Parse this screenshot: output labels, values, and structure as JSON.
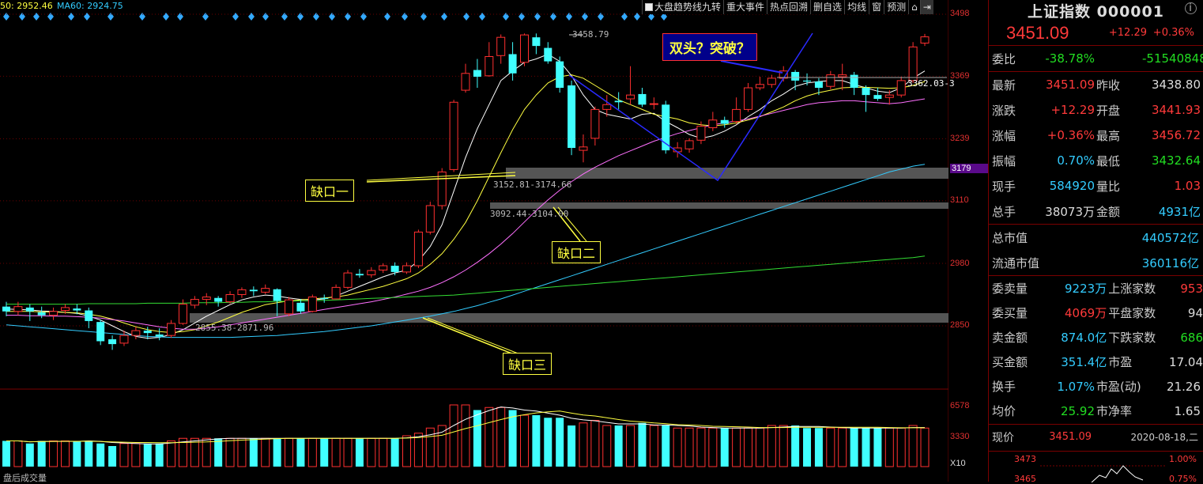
{
  "ma_legend": {
    "ma50": "50: 2952.46",
    "ma60": "MA60: 2924.75"
  },
  "toolbar": {
    "trend": "大盘趋势线九转",
    "events": "重大事件",
    "hot": "热点回溯",
    "delete": "删自选",
    "avg": "均线",
    "window": "窗",
    "forecast": "预测"
  },
  "yaxis": [
    "3498",
    "3369",
    "3239",
    "3179",
    "3110",
    "2980",
    "2850"
  ],
  "vol_axis": {
    "top": "6578",
    "mid": "3330",
    "unit": "X10"
  },
  "vol_label": "盘后成交量",
  "annotations": {
    "gap1": "缺口一",
    "gap2": "缺口二",
    "gap3": "缺口三",
    "question": "双头？突破？"
  },
  "labels": {
    "high": "3458.79",
    "gap1_range": "3152.81-3174.66",
    "gap2_range": "3092.44-3104.00",
    "gap3_range": "2855.38-2871.96",
    "ma_val": "3362.03-3"
  },
  "colors": {
    "up": "#ff3030",
    "down": "#40ffff",
    "ma5": "#ffffff",
    "ma10": "#ffff40",
    "ma20": "#ff70ff",
    "ma60": "#33ccff",
    "ma120": "#33dd33"
  },
  "chart_data": {
    "type": "candlestick",
    "ylim": [
      2760,
      3510
    ],
    "candles": [
      [
        2890,
        2880,
        2900,
        2870
      ],
      [
        2880,
        2890,
        2900,
        2872
      ],
      [
        2888,
        2880,
        2895,
        2860
      ],
      [
        2878,
        2872,
        2890,
        2866
      ],
      [
        2872,
        2880,
        2888,
        2862
      ],
      [
        2882,
        2888,
        2895,
        2875
      ],
      [
        2886,
        2882,
        2895,
        2874
      ],
      [
        2882,
        2860,
        2888,
        2845
      ],
      [
        2858,
        2818,
        2862,
        2810
      ],
      [
        2822,
        2812,
        2830,
        2800
      ],
      [
        2814,
        2830,
        2840,
        2808
      ],
      [
        2830,
        2840,
        2848,
        2822
      ],
      [
        2840,
        2835,
        2848,
        2822
      ],
      [
        2832,
        2828,
        2845,
        2820
      ],
      [
        2830,
        2855,
        2862,
        2825
      ],
      [
        2855,
        2895,
        2905,
        2852
      ],
      [
        2893,
        2905,
        2912,
        2886
      ],
      [
        2905,
        2910,
        2918,
        2893
      ],
      [
        2908,
        2900,
        2912,
        2890
      ],
      [
        2900,
        2915,
        2922,
        2896
      ],
      [
        2915,
        2925,
        2930,
        2908
      ],
      [
        2925,
        2922,
        2932,
        2912
      ],
      [
        2920,
        2928,
        2936,
        2916
      ],
      [
        2926,
        2902,
        2928,
        2870
      ],
      [
        2875,
        2904,
        2910,
        2870
      ],
      [
        2898,
        2880,
        2906,
        2875
      ],
      [
        2880,
        2910,
        2915,
        2878
      ],
      [
        2908,
        2906,
        2915,
        2898
      ],
      [
        2906,
        2930,
        2936,
        2905
      ],
      [
        2930,
        2960,
        2966,
        2926
      ],
      [
        2958,
        2955,
        2968,
        2950
      ],
      [
        2956,
        2965,
        2972,
        2950
      ],
      [
        2966,
        2975,
        2980,
        2960
      ],
      [
        2975,
        2962,
        2982,
        2955
      ],
      [
        2962,
        2975,
        2982,
        2958
      ],
      [
        2975,
        3045,
        3050,
        2970
      ],
      [
        3045,
        3100,
        3108,
        3040
      ],
      [
        3100,
        3170,
        3178,
        3092
      ],
      [
        3175,
        3315,
        3320,
        3170
      ],
      [
        3340,
        3375,
        3395,
        3335
      ],
      [
        3382,
        3368,
        3405,
        3345
      ],
      [
        3370,
        3410,
        3440,
        3368
      ],
      [
        3412,
        3450,
        3456,
        3395
      ],
      [
        3415,
        3375,
        3440,
        3360
      ],
      [
        3398,
        3455,
        3458,
        3390
      ],
      [
        3450,
        3432,
        3458,
        3415
      ],
      [
        3428,
        3400,
        3440,
        3395
      ],
      [
        3400,
        3345,
        3410,
        3335
      ],
      [
        3350,
        3220,
        3360,
        3205
      ],
      [
        3215,
        3222,
        3248,
        3190
      ],
      [
        3240,
        3300,
        3306,
        3225
      ],
      [
        3300,
        3310,
        3330,
        3285
      ],
      [
        3318,
        3315,
        3336,
        3300
      ],
      [
        3322,
        3330,
        3390,
        3310
      ],
      [
        3332,
        3310,
        3345,
        3305
      ],
      [
        3312,
        3312,
        3325,
        3300
      ],
      [
        3310,
        3215,
        3318,
        3208
      ],
      [
        3212,
        3220,
        3232,
        3200
      ],
      [
        3218,
        3235,
        3240,
        3210
      ],
      [
        3236,
        3265,
        3275,
        3228
      ],
      [
        3262,
        3278,
        3295,
        3255
      ],
      [
        3278,
        3270,
        3285,
        3262
      ],
      [
        3275,
        3300,
        3325,
        3270
      ],
      [
        3300,
        3345,
        3355,
        3295
      ],
      [
        3345,
        3352,
        3368,
        3340
      ],
      [
        3352,
        3365,
        3372,
        3345
      ],
      [
        3365,
        3380,
        3390,
        3358
      ],
      [
        3378,
        3360,
        3382,
        3340
      ],
      [
        3360,
        3358,
        3375,
        3350
      ],
      [
        3358,
        3345,
        3365,
        3330
      ],
      [
        3348,
        3372,
        3380,
        3342
      ],
      [
        3368,
        3372,
        3395,
        3340
      ],
      [
        3372,
        3345,
        3378,
        3330
      ],
      [
        3345,
        3330,
        3350,
        3295
      ],
      [
        3330,
        3322,
        3345,
        3318
      ],
      [
        3325,
        3330,
        3340,
        3310
      ],
      [
        3330,
        3360,
        3368,
        3325
      ],
      [
        3360,
        3430,
        3440,
        3355
      ],
      [
        3438,
        3451,
        3457,
        3432
      ]
    ],
    "volume": [
      10,
      10,
      9,
      10,
      10,
      10,
      10,
      10,
      9,
      8,
      9,
      9,
      9,
      9,
      10,
      11,
      11,
      11,
      11,
      11,
      11,
      11,
      11,
      11,
      11,
      11,
      11,
      11,
      11,
      11,
      11,
      11,
      11,
      11,
      12,
      13,
      15,
      16,
      24,
      24,
      22,
      23,
      23,
      22,
      20,
      20,
      19,
      19,
      16,
      17,
      18,
      16,
      16,
      16,
      17,
      16,
      16,
      15,
      15,
      15,
      15,
      15,
      15,
      15,
      15,
      16,
      16,
      16,
      15,
      15,
      15,
      15,
      15,
      15,
      15,
      15,
      15,
      16,
      15
    ],
    "ma_lines": {
      "ma5": [
        2885,
        2884,
        2883,
        2881,
        2880,
        2878,
        2876,
        2870,
        2862,
        2850,
        2838,
        2828,
        2824,
        2826,
        2832,
        2842,
        2856,
        2870,
        2882,
        2894,
        2904,
        2910,
        2914,
        2912,
        2908,
        2905,
        2904,
        2906,
        2912,
        2922,
        2932,
        2942,
        2952,
        2960,
        2966,
        2985,
        3015,
        3060,
        3130,
        3200,
        3260,
        3310,
        3360,
        3380,
        3398,
        3405,
        3415,
        3400,
        3370,
        3330,
        3300,
        3290,
        3285,
        3280,
        3290,
        3292,
        3275,
        3262,
        3248,
        3240,
        3245,
        3255,
        3268,
        3285,
        3300,
        3318,
        3332,
        3348,
        3355,
        3358,
        3360,
        3360,
        3352,
        3345,
        3338,
        3335,
        3345,
        3365,
        3380
      ],
      "ma10": [
        2880,
        2880,
        2880,
        2879,
        2879,
        2878,
        2877,
        2874,
        2870,
        2864,
        2856,
        2848,
        2842,
        2838,
        2836,
        2838,
        2842,
        2850,
        2858,
        2868,
        2878,
        2886,
        2894,
        2898,
        2902,
        2904,
        2906,
        2908,
        2910,
        2914,
        2920,
        2926,
        2932,
        2940,
        2948,
        2960,
        2978,
        3000,
        3030,
        3065,
        3110,
        3160,
        3210,
        3258,
        3300,
        3330,
        3355,
        3368,
        3372,
        3365,
        3350,
        3335,
        3320,
        3310,
        3300,
        3290,
        3285,
        3280,
        3272,
        3268,
        3266,
        3268,
        3272,
        3278,
        3285,
        3295,
        3305,
        3318,
        3328,
        3335,
        3340,
        3345,
        3346,
        3346,
        3345,
        3344,
        3345,
        3350,
        3358
      ],
      "ma20": [
        2872,
        2872,
        2871,
        2871,
        2870,
        2870,
        2869,
        2868,
        2866,
        2863,
        2860,
        2856,
        2852,
        2848,
        2845,
        2843,
        2843,
        2845,
        2848,
        2852,
        2856,
        2860,
        2864,
        2868,
        2872,
        2876,
        2880,
        2884,
        2888,
        2892,
        2896,
        2900,
        2905,
        2910,
        2916,
        2922,
        2930,
        2940,
        2952,
        2966,
        2982,
        3000,
        3020,
        3042,
        3066,
        3090,
        3112,
        3132,
        3150,
        3166,
        3180,
        3192,
        3204,
        3214,
        3224,
        3234,
        3242,
        3250,
        3256,
        3262,
        3268,
        3272,
        3276,
        3280,
        3286,
        3292,
        3298,
        3304,
        3310,
        3314,
        3316,
        3318,
        3318,
        3316,
        3314,
        3312,
        3314,
        3318,
        3322
      ],
      "ma60": [
        2852,
        2850,
        2848,
        2846,
        2844,
        2842,
        2840,
        2838,
        2836,
        2834,
        2832,
        2830,
        2828,
        2827,
        2826,
        2826,
        2826,
        2826,
        2826,
        2826,
        2827,
        2828,
        2829,
        2830,
        2832,
        2834,
        2836,
        2838,
        2841,
        2844,
        2847,
        2850,
        2854,
        2858,
        2862,
        2866,
        2870,
        2875,
        2880,
        2886,
        2892,
        2899,
        2906,
        2914,
        2922,
        2930,
        2938,
        2946,
        2954,
        2962,
        2970,
        2978,
        2986,
        2994,
        3002,
        3010,
        3018,
        3026,
        3034,
        3042,
        3050,
        3058,
        3066,
        3074,
        3082,
        3090,
        3098,
        3106,
        3114,
        3122,
        3130,
        3138,
        3146,
        3154,
        3162,
        3170,
        3176,
        3182,
        3186
      ],
      "ma120": [
        2895,
        2895,
        2895,
        2895,
        2895,
        2895,
        2895,
        2896,
        2896,
        2896,
        2896,
        2896,
        2897,
        2897,
        2897,
        2897,
        2898,
        2898,
        2898,
        2899,
        2899,
        2900,
        2900,
        2901,
        2901,
        2902,
        2902,
        2903,
        2904,
        2905,
        2906,
        2907,
        2908,
        2909,
        2910,
        2911,
        2912,
        2913,
        2914,
        2916,
        2918,
        2920,
        2922,
        2924,
        2926,
        2928,
        2930,
        2932,
        2934,
        2936,
        2938,
        2940,
        2942,
        2944,
        2946,
        2948,
        2950,
        2952,
        2954,
        2956,
        2958,
        2960,
        2962,
        2964,
        2966,
        2968,
        2970,
        2972,
        2974,
        2976,
        2978,
        2980,
        2982,
        2984,
        2986,
        2988,
        2990,
        2992,
        2995
      ]
    }
  },
  "panel": {
    "title": "上证指数 000001",
    "price": "3451.09",
    "change": "+12.29",
    "change_pct": "+0.36%",
    "rows1": [
      {
        "l1": "委比",
        "v1": "-38.78%",
        "c1": "green",
        "l2": "",
        "v2": "-51540848",
        "c2": "green"
      }
    ],
    "rows2": [
      {
        "l1": "最新",
        "v1": "3451.09",
        "c1": "red",
        "l2": "昨收",
        "v2": "3438.80",
        "c2": "white"
      },
      {
        "l1": "涨跌",
        "v1": "+12.29",
        "c1": "red",
        "l2": "开盘",
        "v2": "3441.93",
        "c2": "red"
      },
      {
        "l1": "涨幅",
        "v1": "+0.36%",
        "c1": "red",
        "l2": "最高",
        "v2": "3456.72",
        "c2": "red"
      },
      {
        "l1": "振幅",
        "v1": "0.70%",
        "c1": "cyan",
        "l2": "最低",
        "v2": "3432.64",
        "c2": "green"
      },
      {
        "l1": "现手",
        "v1": "584920",
        "c1": "cyan",
        "l2": "量比",
        "v2": "1.03",
        "c2": "red"
      },
      {
        "l1": "总手",
        "v1": "38073万",
        "c1": "white",
        "l2": "金额",
        "v2": "4931亿",
        "c2": "cyan"
      }
    ],
    "rows3": [
      {
        "l1": "总市值",
        "v2": "440572亿"
      },
      {
        "l1": "流通市值",
        "v2": "360116亿"
      }
    ],
    "rows4": [
      {
        "l1": "委卖量",
        "v1": "9223万",
        "c1": "cyan",
        "l2": "上涨家数",
        "v2": "953",
        "c2": "red"
      },
      {
        "l1": "委买量",
        "v1": "4069万",
        "c1": "red",
        "l2": "平盘家数",
        "v2": "94",
        "c2": "white"
      },
      {
        "l1": "卖金额",
        "v1": "874.0亿",
        "c1": "cyan",
        "l2": "下跌家数",
        "v2": "686",
        "c2": "green"
      },
      {
        "l1": "买金额",
        "v1": "351.4亿",
        "c1": "cyan",
        "l2": "市盈",
        "v2": "17.04",
        "c2": "white"
      },
      {
        "l1": "换手",
        "v1": "1.07%",
        "c1": "cyan",
        "l2": "市盈(动)",
        "v2": "21.26",
        "c2": "white"
      },
      {
        "l1": "均价",
        "v1": "25.92",
        "c1": "green",
        "l2": "市净率",
        "v2": "1.65",
        "c2": "white"
      }
    ],
    "bottom": {
      "l": "现价",
      "v": "3451.09",
      "date": "2020-08-18,二"
    },
    "mini": {
      "top_l": "3473",
      "top_r": "1.00%",
      "bot_l": "3465",
      "bot_r": "0.75%"
    }
  }
}
